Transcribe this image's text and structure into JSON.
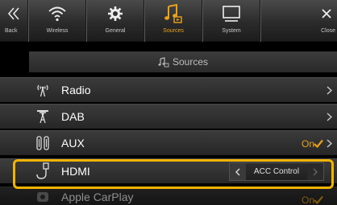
{
  "nav": {
    "back": "Back",
    "wireless": "Wireless",
    "general": "General",
    "sources": "Sources",
    "system": "System",
    "close": "Close",
    "active": "sources"
  },
  "section": {
    "title": "Sources"
  },
  "rows": [
    {
      "label": "Radio",
      "icon": "radio-antenna-icon"
    },
    {
      "label": "DAB",
      "icon": "dab-antenna-icon"
    },
    {
      "label": "AUX",
      "icon": "aux-plug-icon",
      "value": "On"
    },
    {
      "label": "HDMI",
      "icon": "hdmi-plug-icon",
      "control": "ACC Control"
    },
    {
      "label": "Apple CarPlay",
      "icon": "carplay-icon",
      "value": "On"
    }
  ],
  "colors": {
    "accent": "#e9a21a",
    "highlight": "#f2b400"
  }
}
